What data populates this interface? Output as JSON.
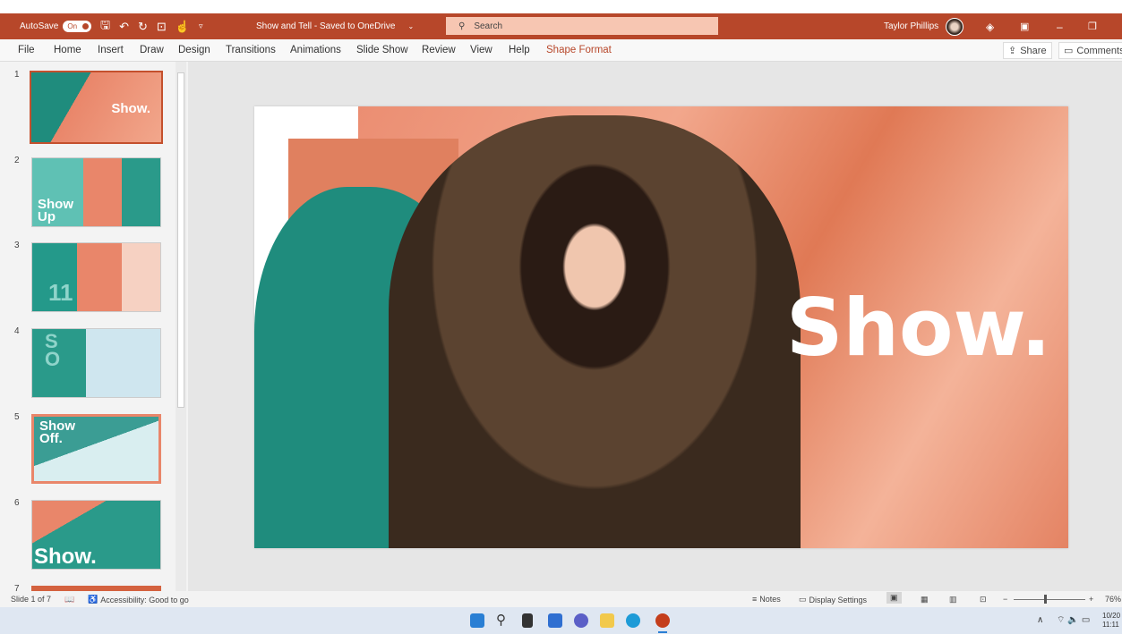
{
  "titlebar": {
    "autosave_label": "AutoSave",
    "autosave_state": "On",
    "doc_title": "Show and Tell - Saved to OneDrive",
    "search_placeholder": "Search",
    "user_name": "Taylor Phillips"
  },
  "ribbon": {
    "tabs": [
      "File",
      "Home",
      "Insert",
      "Draw",
      "Design",
      "Transitions",
      "Animations",
      "Slide Show",
      "Review",
      "View",
      "Help",
      "Shape Format"
    ],
    "share": "Share",
    "comments": "Comments"
  },
  "thumbnails": [
    {
      "num": "1",
      "text": "Show."
    },
    {
      "num": "2",
      "text": "Show Up"
    },
    {
      "num": "3",
      "text": "11"
    },
    {
      "num": "4",
      "text": "S O"
    },
    {
      "num": "5",
      "text": "Show Off."
    },
    {
      "num": "6",
      "text": "Show."
    },
    {
      "num": "7",
      "text": ""
    }
  ],
  "slide": {
    "headline": "Show."
  },
  "status": {
    "slide_info": "Slide 1 of 7",
    "accessibility": "Accessibility: Good to go",
    "notes": "Notes",
    "display_settings": "Display Settings",
    "zoom": "76%"
  },
  "taskbar": {
    "date": "10/20",
    "time": "11:11"
  },
  "colors": {
    "accent": "#b7472a",
    "slide_orange": "#e9866a",
    "teal": "#1f8c7d"
  }
}
